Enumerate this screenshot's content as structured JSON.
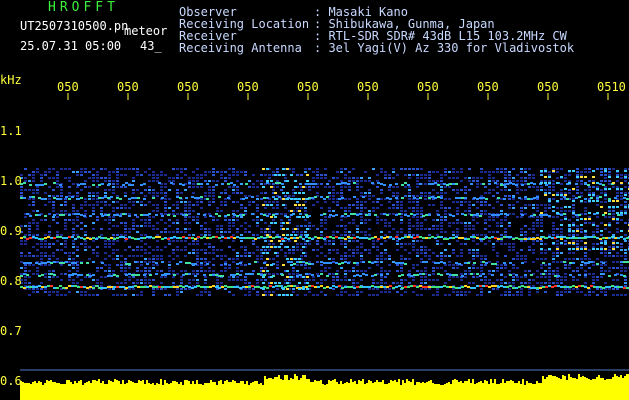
{
  "header": {
    "brand": "HROFFT",
    "filename": "UT2507310500.pn",
    "meteor_label": "meteor",
    "datetime": "25.07.31 05:00",
    "count": "43_"
  },
  "info": [
    {
      "key": "Observer",
      "value": ": Masaki Kano"
    },
    {
      "key": "Receiving Location",
      "value": ": Shibukawa, Gunma, Japan"
    },
    {
      "key": "Receiver",
      "value": ": RTL-SDR SDR# 43dB L15 103.2MHz CW"
    },
    {
      "key": "Receiving Antenna",
      "value": ": 3el Yagi(V) Az 330 for Vladivostok"
    }
  ],
  "axes": {
    "y_unit": "kHz",
    "y_ticks": [
      "1.1",
      "1.0",
      "0.9",
      "0.8",
      "0.7",
      "0.6"
    ],
    "x_ticks": [
      "050",
      "050",
      "050",
      "050",
      "050",
      "050",
      "050",
      "050",
      "050",
      "0510"
    ]
  },
  "colors": {
    "background": "#000000",
    "text_green": "#3cf03c",
    "text_yellow": "#ffff3c",
    "band_blue": "#1e2ea0",
    "signal_red": "#ff3020",
    "level_yellow": "#ffff00"
  }
}
